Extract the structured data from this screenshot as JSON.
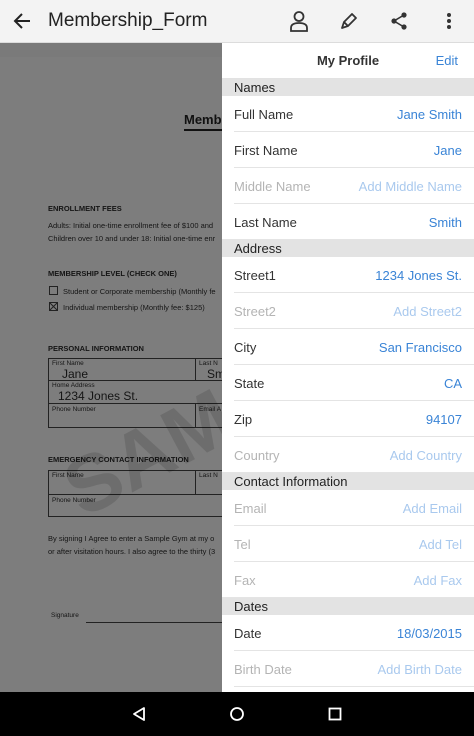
{
  "appbar": {
    "title": "Membership_Form",
    "icons": [
      "back-arrow-icon",
      "person-icon",
      "pen-icon",
      "share-icon",
      "more-vert-icon"
    ]
  },
  "document": {
    "form_title_partial": "Membe",
    "enrollment_heading": "ENROLLMENT FEES",
    "enrollment_line1": "Adults: Initial one-time enrollment fee of $100 and",
    "enrollment_line2": "Children over 10 and under 18: Initial one-time enr",
    "level_heading": "MEMBERSHIP LEVEL (CHECK ONE)",
    "level_option1": "Student or Corporate membership (Monthly fe",
    "level_option2": "Individual membership (Monthly fee: $125)",
    "personal_heading": "PERSONAL INFORMATION",
    "first_name_label": "First Name",
    "first_name_value": "Jane",
    "last_name_label": "Last N",
    "last_name_value": "Sm",
    "home_address_label": "Home Address",
    "home_address_value": "1234 Jones St.",
    "phone_label": "Phone Number",
    "email_label": "Email A",
    "emergency_heading": "EMERGENCY CONTACT INFORMATION",
    "em_first_label": "First Name",
    "em_last_label": "Last N",
    "em_phone_label": "Phone Number",
    "signing_line1": "By signing I Agree to enter a Sample Gym at my o",
    "signing_line2": "or after visitation hours. I also agree to the thirty (3",
    "signature_label": "Signature",
    "watermark": "SAM"
  },
  "panel": {
    "title": "My Profile",
    "edit_label": "Edit",
    "sections": {
      "names": "Names",
      "address": "Address",
      "contact": "Contact Information",
      "dates": "Dates"
    },
    "fields": {
      "full_name": {
        "label": "Full Name",
        "value": "Jane Smith"
      },
      "first_name": {
        "label": "First Name",
        "value": "Jane"
      },
      "middle_name": {
        "label": "Middle Name",
        "value": "Add Middle Name"
      },
      "last_name": {
        "label": "Last Name",
        "value": "Smith"
      },
      "street1": {
        "label": "Street1",
        "value": "1234 Jones St."
      },
      "street2": {
        "label": "Street2",
        "value": "Add Street2"
      },
      "city": {
        "label": "City",
        "value": "San Francisco"
      },
      "state": {
        "label": "State",
        "value": "CA"
      },
      "zip": {
        "label": "Zip",
        "value": "94107"
      },
      "country": {
        "label": "Country",
        "value": "Add Country"
      },
      "email": {
        "label": "Email",
        "value": "Add Email"
      },
      "tel": {
        "label": "Tel",
        "value": "Add Tel"
      },
      "fax": {
        "label": "Fax",
        "value": "Add Fax"
      },
      "date": {
        "label": "Date",
        "value": "18/03/2015"
      },
      "birth_date": {
        "label": "Birth Date",
        "value": "Add Birth Date"
      }
    }
  },
  "navbar": {
    "icons": [
      "nav-back-icon",
      "nav-home-icon",
      "nav-recents-icon"
    ]
  },
  "colors": {
    "accent": "#3a84d6",
    "placeholder": "#a9c9ee",
    "section_bg": "#e3e3e3",
    "appbar_bg": "#f3f3f3"
  }
}
